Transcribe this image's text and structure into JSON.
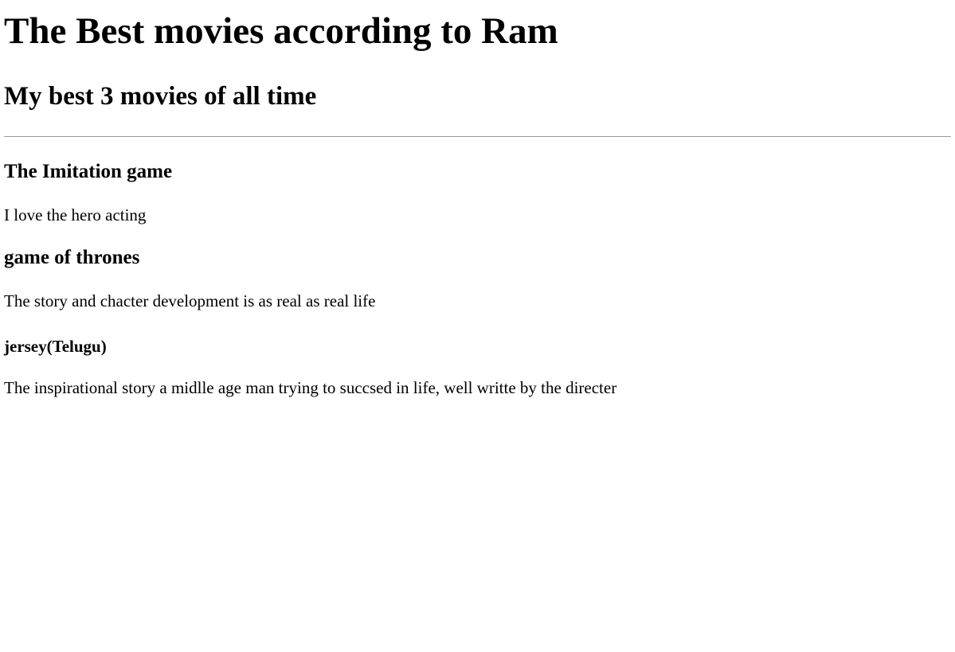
{
  "page": {
    "title": "The Best movies according to Ram",
    "subtitle": "My best 3 movies of all time"
  },
  "movies": [
    {
      "name": "The Imitation game",
      "description": "I love the hero acting"
    },
    {
      "name": "game of thrones",
      "description": "The story and chacter development is as real as real life"
    },
    {
      "name": "jersey(Telugu)",
      "description": "The inspirational story a midlle age man trying to succsed in life, well writte by the directer"
    }
  ]
}
